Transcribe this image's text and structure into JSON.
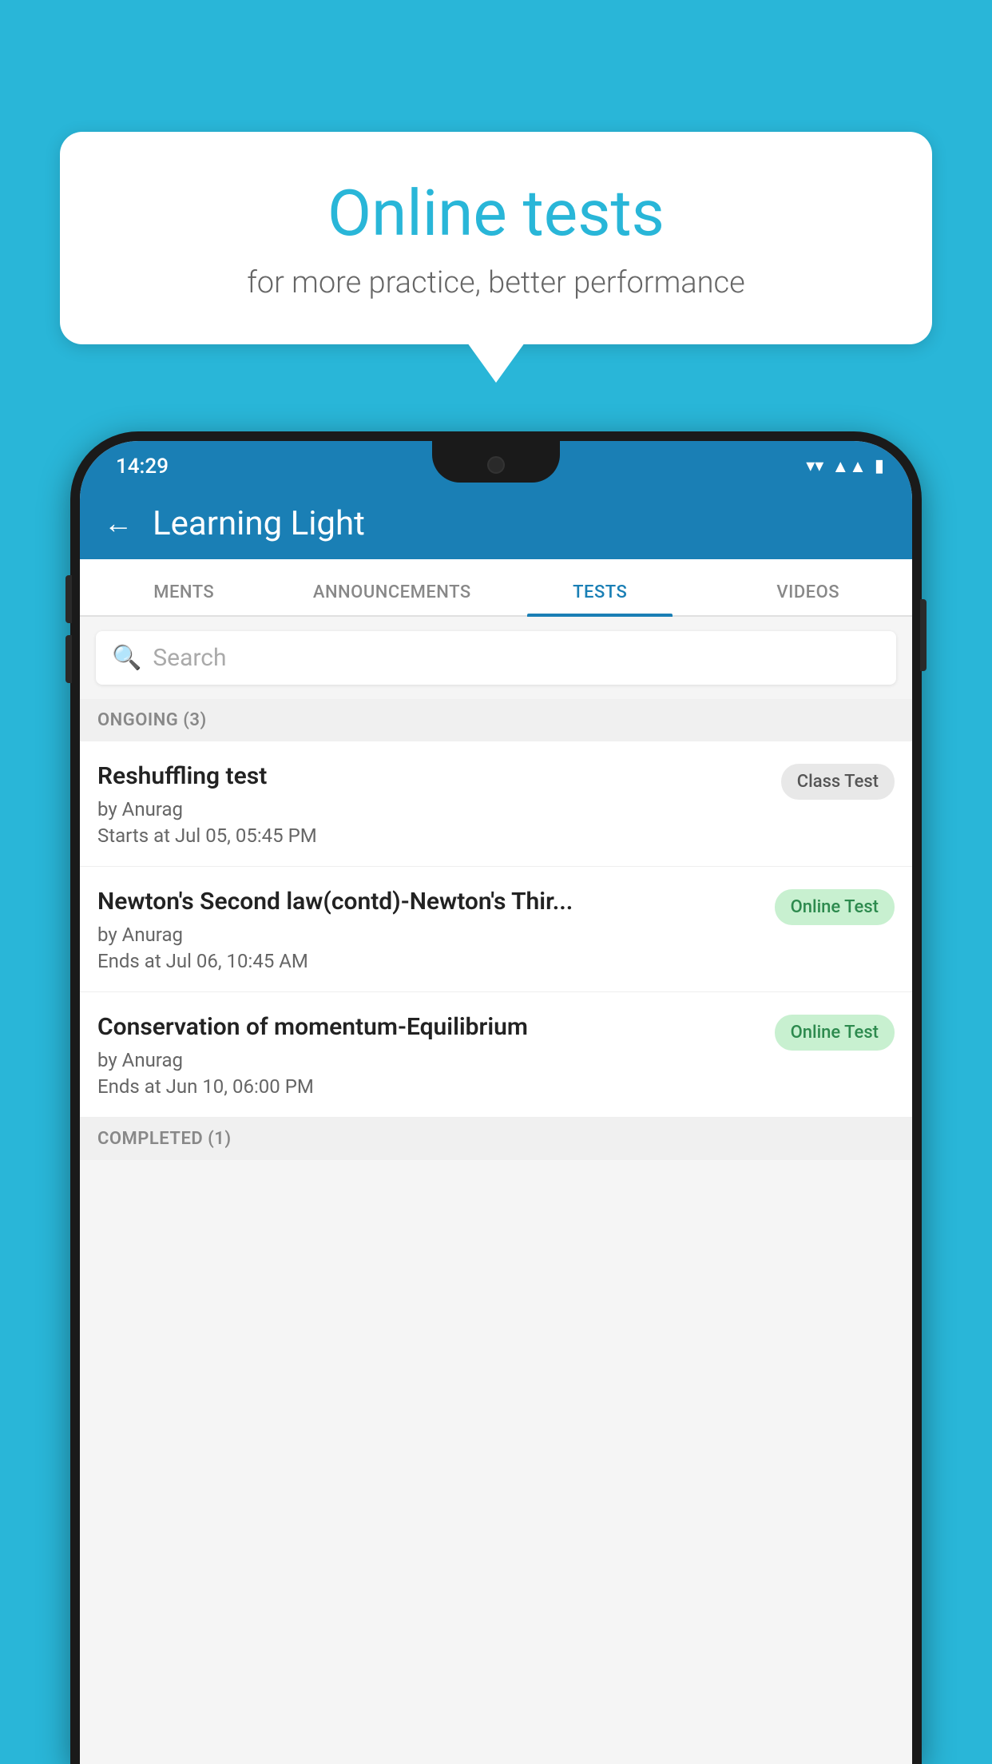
{
  "background_color": "#29b6d8",
  "bubble": {
    "title": "Online tests",
    "subtitle": "for more practice, better performance"
  },
  "phone": {
    "status_bar": {
      "time": "14:29",
      "wifi_icon": "▼",
      "signal_icon": "▲",
      "battery_icon": "▮"
    },
    "header": {
      "back_label": "←",
      "title": "Learning Light"
    },
    "tabs": [
      {
        "label": "MENTS",
        "active": false
      },
      {
        "label": "ANNOUNCEMENTS",
        "active": false
      },
      {
        "label": "TESTS",
        "active": true
      },
      {
        "label": "VIDEOS",
        "active": false
      }
    ],
    "search": {
      "placeholder": "Search"
    },
    "sections": [
      {
        "header": "ONGOING (3)",
        "items": [
          {
            "name": "Reshuffling test",
            "author": "by Anurag",
            "time_label": "Starts at",
            "time": "Jul 05, 05:45 PM",
            "badge": "Class Test",
            "badge_type": "class"
          },
          {
            "name": "Newton's Second law(contd)-Newton's Thir...",
            "author": "by Anurag",
            "time_label": "Ends at",
            "time": "Jul 06, 10:45 AM",
            "badge": "Online Test",
            "badge_type": "online"
          },
          {
            "name": "Conservation of momentum-Equilibrium",
            "author": "by Anurag",
            "time_label": "Ends at",
            "time": "Jun 10, 06:00 PM",
            "badge": "Online Test",
            "badge_type": "online"
          }
        ]
      },
      {
        "header": "COMPLETED (1)",
        "items": []
      }
    ]
  }
}
